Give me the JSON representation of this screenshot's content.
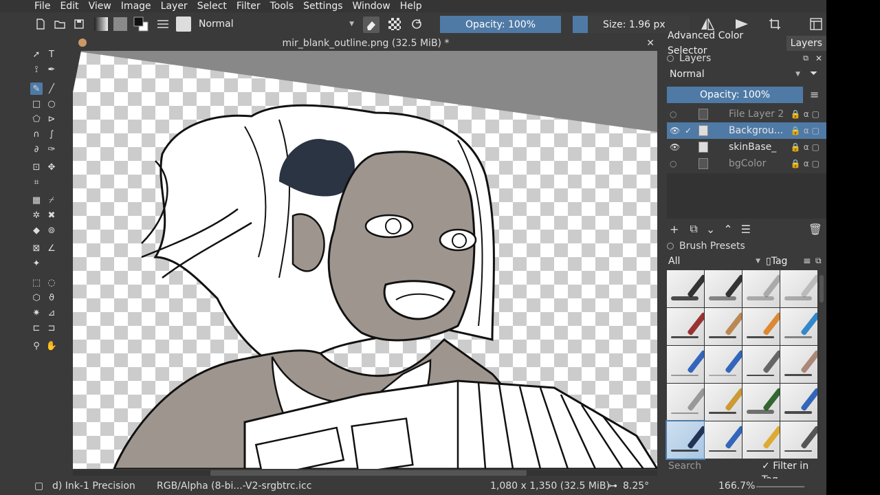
{
  "menu": [
    "File",
    "Edit",
    "View",
    "Image",
    "Layer",
    "Select",
    "Filter",
    "Tools",
    "Settings",
    "Window",
    "Help"
  ],
  "toolbar": {
    "blend_mode": "Normal",
    "opacity": "Opacity: 100%",
    "size": "Size: 1.96 px",
    "accent": "#4f7aa6"
  },
  "document": {
    "tab_title": "mir_blank_outline.png (32.5 MiB) *"
  },
  "docker": {
    "tabs": [
      "Advanced Color Selector",
      "Layers"
    ],
    "layers_title": "Layers",
    "blend_mode": "Normal",
    "opacity": "Opacity:  100%",
    "layers": [
      {
        "name": "File Layer 2",
        "visible": false,
        "selected": false
      },
      {
        "name": "Backgrou...",
        "visible": true,
        "selected": true
      },
      {
        "name": "skinBase_",
        "visible": true,
        "selected": false
      },
      {
        "name": "bgColor",
        "visible": false,
        "selected": false
      }
    ],
    "presets_title": "Brush Presets",
    "presets_filter": "All",
    "presets_tag": "Tag",
    "search_placeholder": "Search",
    "filter_in_tag": "Filter in Tag"
  },
  "status": {
    "brush": "d) Ink-1 Precision",
    "color_space": "RGB/Alpha (8-bi...-V2-srgbtrc.icc",
    "dimensions": "1,080 x 1,350 (32.5 MiB)",
    "rotation": "8.25°",
    "zoom": "166.7%"
  }
}
